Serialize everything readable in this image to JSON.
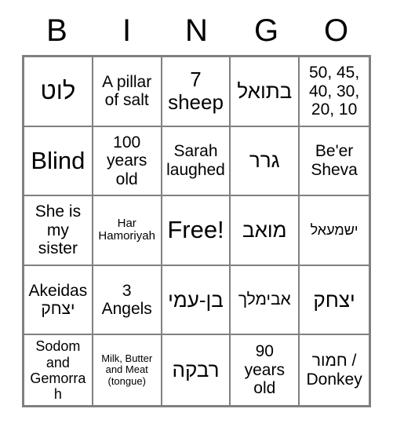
{
  "card": {
    "title": "BINGO Card",
    "header_letters": [
      "B",
      "I",
      "N",
      "G",
      "O"
    ],
    "colors": {
      "border": "#808080",
      "text": "#000000",
      "background": "#ffffff"
    },
    "rows": [
      [
        {
          "text": "לוט",
          "size": "xl",
          "rtl": true
        },
        {
          "text": "A pillar of salt",
          "size": "md",
          "rtl": false
        },
        {
          "text": "7 sheep",
          "size": "lg",
          "rtl": false
        },
        {
          "text": "בתואל",
          "size": "lg",
          "rtl": true
        },
        {
          "text": "50, 45, 40, 30, 20, 10",
          "size": "md",
          "rtl": false
        }
      ],
      [
        {
          "text": "Blind",
          "size": "xl",
          "rtl": false
        },
        {
          "text": "100 years old",
          "size": "md",
          "rtl": false
        },
        {
          "text": "Sarah laughed",
          "size": "md",
          "rtl": false
        },
        {
          "text": "גרר",
          "size": "lg",
          "rtl": true
        },
        {
          "text": "Be'er Sheva",
          "size": "md",
          "rtl": false
        }
      ],
      [
        {
          "text": "She is my sister",
          "size": "md",
          "rtl": false
        },
        {
          "text": "Har Hamoriyah",
          "size": "xs",
          "rtl": false
        },
        {
          "text": "Free!",
          "size": "xl",
          "rtl": false
        },
        {
          "text": "מואב",
          "size": "lg",
          "rtl": true
        },
        {
          "text": "ישמעאל",
          "size": "sm",
          "rtl": true
        }
      ],
      [
        {
          "text": "Akeidas יצחק",
          "size": "md",
          "rtl": false
        },
        {
          "text": "3 Angels",
          "size": "md",
          "rtl": false
        },
        {
          "text": "בן-עמי",
          "size": "lg",
          "rtl": true
        },
        {
          "text": "אבימלך",
          "size": "md",
          "rtl": true
        },
        {
          "text": "יצחק",
          "size": "lg",
          "rtl": true
        }
      ],
      [
        {
          "text": "Sodom and Gemorrah",
          "size": "sm",
          "rtl": false
        },
        {
          "text": "Milk, Butter and Meat (tongue)",
          "size": "xxs",
          "rtl": false
        },
        {
          "text": "רבקה",
          "size": "lg",
          "rtl": true
        },
        {
          "text": "90 years old",
          "size": "md",
          "rtl": false
        },
        {
          "text": "חמור / Donkey",
          "size": "md",
          "rtl": false
        }
      ]
    ]
  }
}
